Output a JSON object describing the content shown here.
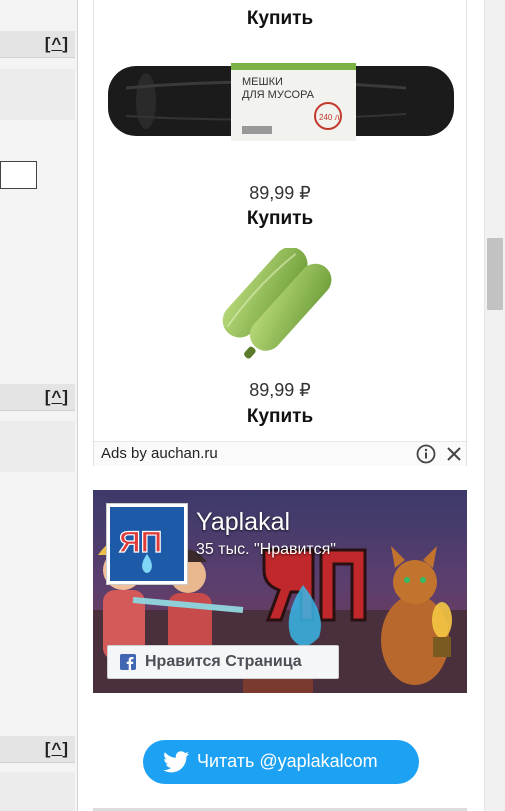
{
  "left_column": {
    "up_links": [
      "[^]",
      "[^]",
      "[^]"
    ]
  },
  "ad": {
    "products": [
      {
        "name": "bags-product",
        "price": "",
        "buy_label": "Купить",
        "package_text_1": "МЕШКИ",
        "package_text_2": "ДЛЯ МУСОРА",
        "package_badge": "240 л"
      },
      {
        "name": "bags-product-2",
        "price": "89,99 ₽",
        "buy_label": "Купить"
      },
      {
        "name": "zucchini-product",
        "price": "89,99 ₽",
        "buy_label": "Купить"
      }
    ],
    "footer": {
      "label": "Ads by auchan.ru"
    }
  },
  "facebook": {
    "page_name": "Yaplakal",
    "likes": "35 тыс. \"Нравится\"",
    "like_button": "Нравится Страница",
    "logo_text": "ЯП"
  },
  "twitter": {
    "button_label": "Читать @yaplakalcom"
  },
  "colors": {
    "twitter_blue": "#1da1f2",
    "facebook_blue": "#4267b2"
  }
}
